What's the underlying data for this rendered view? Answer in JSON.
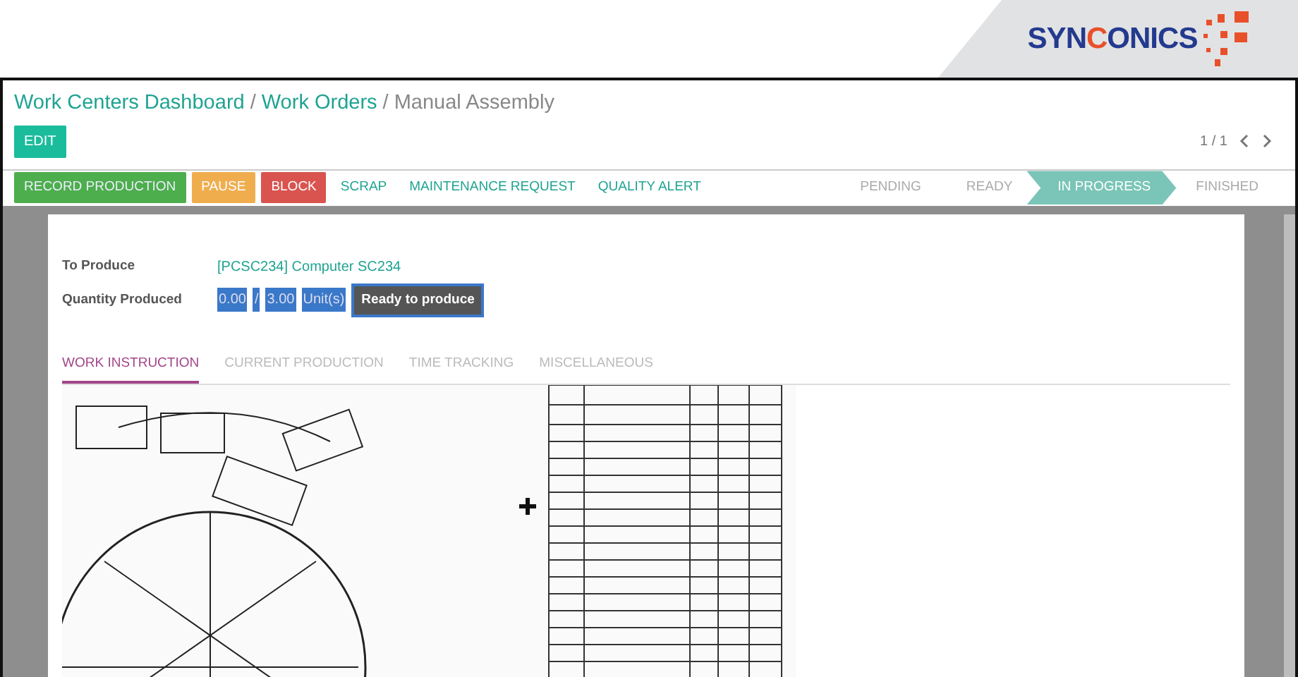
{
  "brand": {
    "logo": "SYNCONICS"
  },
  "breadcrumb": [
    {
      "label": "Work Centers Dashboard",
      "link": true,
      "separator": "/"
    },
    {
      "label": "Work Orders",
      "link": true,
      "separator": "/"
    },
    {
      "label": "Manual Assembly",
      "link": false
    }
  ],
  "edit_button": "EDIT",
  "pager": {
    "text": "1 / 1"
  },
  "actions": [
    {
      "label": "RECORD PRODUCTION",
      "kind": "success"
    },
    {
      "label": "PAUSE",
      "kind": "warning"
    },
    {
      "label": "BLOCK",
      "kind": "danger"
    },
    {
      "label": "SCRAP",
      "kind": "link"
    },
    {
      "label": "MAINTENANCE REQUEST",
      "kind": "link"
    },
    {
      "label": "QUALITY ALERT",
      "kind": "link"
    }
  ],
  "status_bar": [
    {
      "label": "PENDING",
      "selected": false
    },
    {
      "label": "READY",
      "selected": false
    },
    {
      "label": "IN PROGRESS",
      "selected": true
    },
    {
      "label": "FINISHED",
      "selected": false
    }
  ],
  "form": {
    "to_produce_label": "To Produce",
    "to_produce_value": "[PCSC234] Computer SC234",
    "quantity_label": "Quantity Produced",
    "quantity": {
      "produced": "0.00",
      "separator": "/",
      "target": "3.00",
      "unit": "Unit(s)",
      "highlighted": true
    },
    "state_badge": "Ready to produce"
  },
  "tabs": [
    {
      "label": "WORK INSTRUCTION",
      "selected": true
    },
    {
      "label": "CURRENT PRODUCTION",
      "selected": false
    },
    {
      "label": "TIME TRACKING",
      "selected": false
    },
    {
      "label": "MISCELLANEOUS",
      "selected": false
    }
  ]
}
